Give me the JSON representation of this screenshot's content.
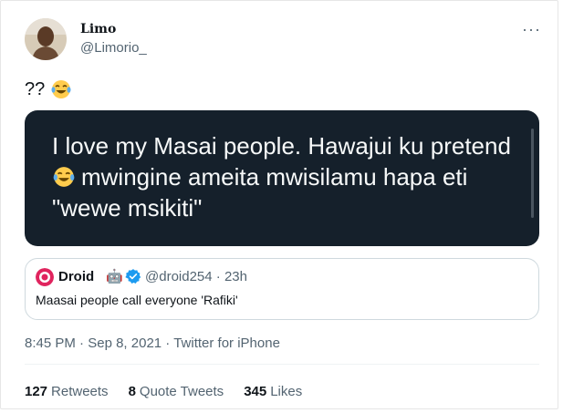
{
  "author": {
    "name": "Limo",
    "handle": "@Limorio_"
  },
  "tweet": {
    "text": "??",
    "emoji": "face-with-tears-of-joy"
  },
  "media": {
    "lines": [
      "I love my Masai people. Hawajui ku pretend",
      "mwingine ameita mwisilamu hapa eti",
      "\"wewe msikiti\""
    ],
    "emoji_in_line": 2
  },
  "quote": {
    "name": "Droid",
    "robot_emoji": "🤖",
    "handle": "@droid254",
    "separator": " · ",
    "time": "23h",
    "text": "Maasai people call everyone 'Rafiki'"
  },
  "meta": {
    "time": "8:45 PM",
    "separator": " · ",
    "date": "Sep 8, 2021",
    "source": "Twitter for iPhone"
  },
  "stats": [
    {
      "count": "127",
      "label": "Retweets"
    },
    {
      "count": "8",
      "label": "Quote Tweets"
    },
    {
      "count": "345",
      "label": "Likes"
    }
  ],
  "colors": {
    "verified": "#1d9bf0",
    "media_bg": "#15202b"
  }
}
